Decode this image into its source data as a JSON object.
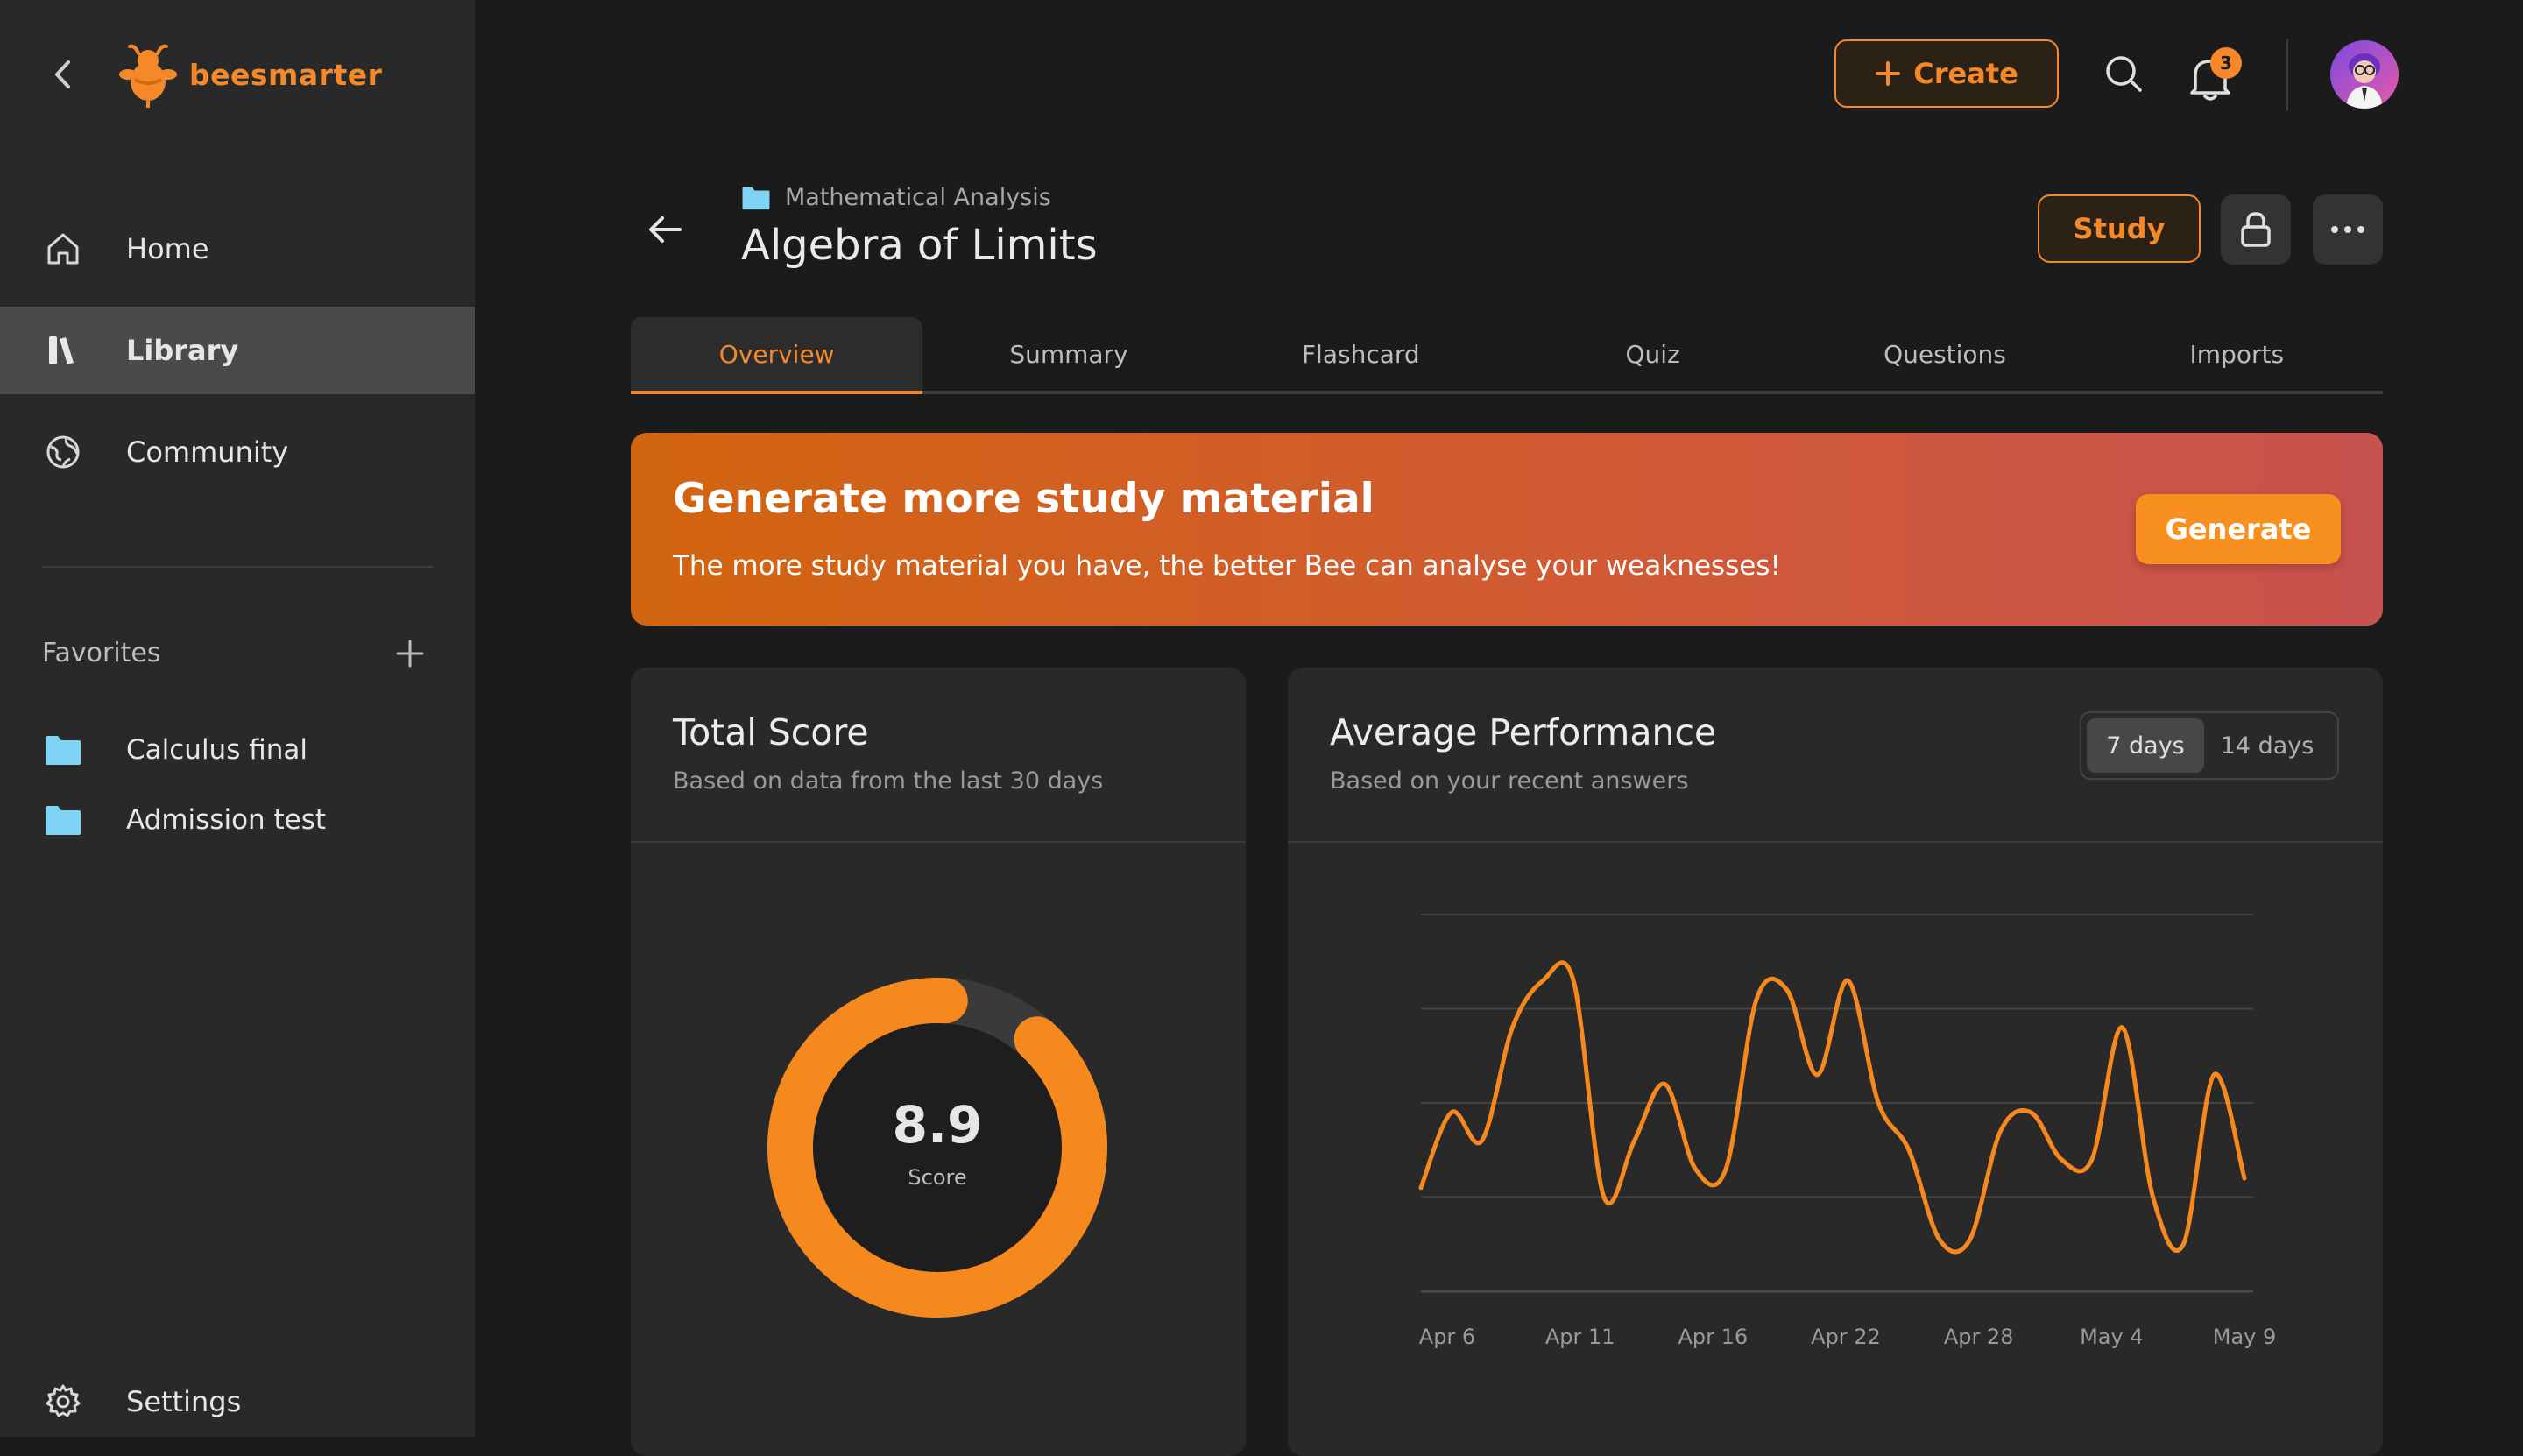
{
  "app": {
    "brand": "beesmarter"
  },
  "sidebar": {
    "items": [
      {
        "label": "Home",
        "icon": "home-icon"
      },
      {
        "label": "Library",
        "icon": "library-icon",
        "active": true
      },
      {
        "label": "Community",
        "icon": "globe-icon"
      }
    ],
    "favorites_title": "Favorites",
    "favorites": [
      {
        "label": "Calculus final",
        "icon": "folder-icon"
      },
      {
        "label": "Admission test",
        "icon": "folder-icon"
      }
    ],
    "settings_label": "Settings"
  },
  "topbar": {
    "create_label": "Create",
    "notification_count": "3"
  },
  "header": {
    "breadcrumb": "Mathematical Analysis",
    "title": "Algebra of Limits",
    "study_label": "Study"
  },
  "tabs": [
    "Overview",
    "Summary",
    "Flashcard",
    "Quiz",
    "Questions",
    "Imports"
  ],
  "banner": {
    "title": "Generate more study material",
    "subtitle": "The more study material you have, the better Bee can analyse your weaknesses!",
    "button": "Generate"
  },
  "score_card": {
    "title": "Total Score",
    "subtitle": "Based on data from the last 30 days",
    "value": "8.9",
    "label": "Score",
    "fraction": 0.89
  },
  "performance_card": {
    "title": "Average Performance",
    "subtitle": "Based on your recent answers",
    "ranges": [
      "7 days",
      "14 days"
    ],
    "selected_range": "7 days"
  },
  "colors": {
    "accent": "#f5892a",
    "folder": "#7fd3f5",
    "background": "#1b1b1b",
    "panel": "#292929"
  },
  "chart_data": {
    "type": "line",
    "x_tick_labels": [
      "Apr 6",
      "Apr 11",
      "Apr 16",
      "Apr 22",
      "Apr 28",
      "May 4",
      "May 9"
    ],
    "ylim": [
      0,
      4
    ],
    "grid": true,
    "series": [
      {
        "values": [
          1.1,
          1.9,
          1.6,
          2.8,
          3.3,
          3.3,
          1.0,
          1.6,
          2.2,
          1.3,
          1.3,
          3.1,
          3.2,
          2.3,
          3.3,
          2.0,
          1.5,
          0.55,
          0.55,
          1.7,
          1.9,
          1.4,
          1.4,
          2.8,
          1.0,
          0.5,
          2.3,
          1.2
        ]
      }
    ]
  }
}
